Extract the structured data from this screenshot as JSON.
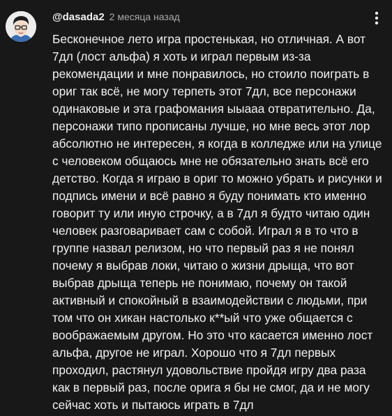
{
  "comment": {
    "author": "@dasada2",
    "timestamp": "2 месяца назад",
    "avatar_icon": "avatar-icon",
    "menu_icon": "more-vertical-icon",
    "lines": [
      "Бесконечное лето игра простенькая, но отличная. А вот",
      "7дл (лост альфа) я хоть и играл первым из-за",
      "рекомендации и мне понравилось, но стоило поиграть в",
      "ориг так всё, не могу терпеть этот 7дл, все персонажи",
      "одинаковые и эта графомания ыыааа отвратительно. Да,",
      "персонажи типо прописаны лучше, но мне весь этот лор",
      "абсолютно не интересен, я когда в колледже или на улице",
      "с человеком общаюсь мне не обязательно знать всё его",
      "детство. Когда я играю в ориг то можно убрать и рисунки и",
      "подпись имени и всё равно я буду понимать кто именно",
      "говорит ту или иную строчку, а в 7дл я будто читаю один",
      "человек разговаривает сам с собой. Играл я в то что в",
      "группе назвал релизом, но что первый раз я не понял",
      "почему я выбрав локи, читаю о жизни дрыща, что вот",
      "выбрав дрыща теперь не понимаю, почему он такой",
      "активный и спокойный в взаимодействии с людьми, при",
      "том что он хикан настолько к**ый что уже общается с",
      "воображаемым другом. Но это что касается именно лост",
      "альфа, другое не играл. Хорошо что я 7дл первых",
      "проходил, растянул удовольствие пройдя игру два раза",
      "как в первый раз, после орига я бы не смог, да и не могу",
      "сейчас хоть и пытаюсь играть в 7дл"
    ]
  },
  "colors": {
    "background": "#181818",
    "text": "#f1f1f1",
    "secondary_text": "#aaaaaa"
  }
}
